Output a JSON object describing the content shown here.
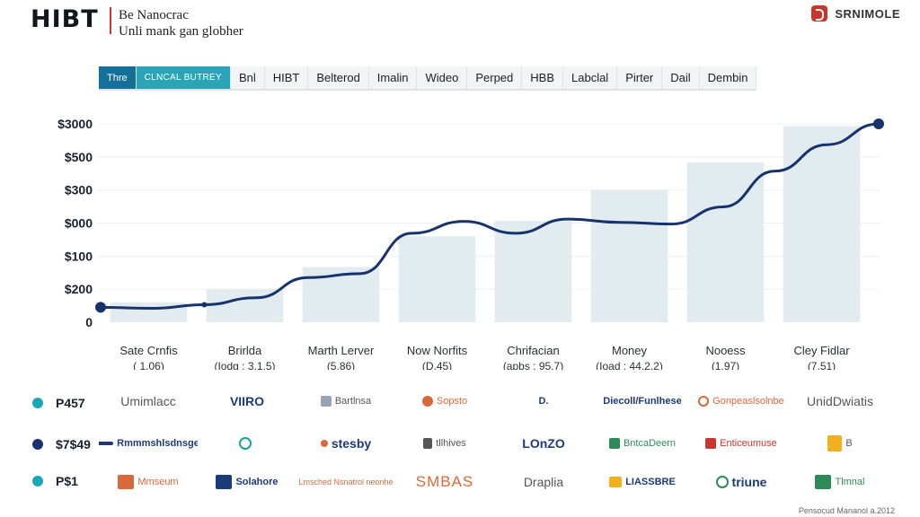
{
  "header": {
    "brand": "HIBT",
    "subtitle_line1": "Be Nanocrac",
    "subtitle_line2": "Unli mank gan globher",
    "logo_text": "SRNIMOLE"
  },
  "tabs": [
    "Thre",
    "CLNCAL BUTREY",
    "Bnl",
    "HIBT",
    "Belterod",
    "Imalin",
    "Wideo",
    "Perped",
    "HBB",
    "Labclal",
    "Pirter",
    "Dail",
    "Dembin"
  ],
  "colors": {
    "line": "#17336e",
    "bar": "#dde9ed",
    "tab_active": "#14709a",
    "tab_active_2": "#2aa5b8",
    "legend_teal": "#1aa8b6",
    "legend_navy": "#17336e",
    "accent_red": "#c9362b"
  },
  "chart_data": {
    "type": "bar",
    "y_ticks": [
      "$3000",
      "$500",
      "$300",
      "$000",
      "$100",
      "$200",
      "0"
    ],
    "categories": [
      {
        "name": "Sate Crnfis",
        "sub": "( 1.06)"
      },
      {
        "name": "Brirlda",
        "sub": "(Iodg : 3.1.5)"
      },
      {
        "name": "Marth Lerver",
        "sub": "(5.86)"
      },
      {
        "name": "Now Norfits",
        "sub": "(D.45)"
      },
      {
        "name": "Chrifacian",
        "sub": "(apbs : 95.7)"
      },
      {
        "name": "Money",
        "sub": "(Ioad : 44,2.2)"
      },
      {
        "name": "Nooess",
        "sub": "(1.97)"
      },
      {
        "name": "Cley Fidlar",
        "sub": "(7.51)"
      }
    ],
    "bar_levels": [
      0,
      0.18,
      0.3,
      0.5,
      0.78,
      0.92,
      1.2,
      1.45,
      1.78
    ],
    "bar_levels_note_removed": true,
    "series": [
      {
        "values": [
          0.45,
          0.42,
          0.53,
          0.74,
          1.35,
          1.47,
          2.69,
          3.05,
          2.69,
          3.12,
          3.02,
          2.97,
          3.49,
          4.57,
          5.37,
          6.0
        ]
      }
    ],
    "ylim": [
      0,
      6
    ],
    "grid": true,
    "legend": "bottom-left"
  },
  "legend": [
    {
      "label": "P457",
      "color": "#1aa8b6"
    },
    {
      "label": "$7$49",
      "color": "#17336e"
    },
    {
      "label": "P$1",
      "color": "#1aa8b6"
    }
  ],
  "brand_rows": [
    [
      {
        "text": "Umimlacc",
        "icon": "wordmark",
        "style": "big"
      },
      {
        "text": "VIIRO",
        "icon": "arc-icon",
        "style": "big"
      },
      {
        "text": "Bartlnsa",
        "icon": "grid-icon",
        "style": ""
      },
      {
        "text": "Sopsto",
        "icon": "flame-icon",
        "style": "orange"
      },
      {
        "text": "D.",
        "icon": "none",
        "style": "navy"
      },
      {
        "text": "Diecoll/Funlhese",
        "icon": "none",
        "style": "navy"
      },
      {
        "text": "Gonpeaslsolnbe",
        "icon": "ring-icon",
        "style": "orange"
      },
      {
        "text": "UnidDwiatis",
        "icon": "none",
        "style": "big"
      }
    ],
    [
      {
        "text": "Rmmmshlsdnsge",
        "icon": "swoosh-icon",
        "style": "navy"
      },
      {
        "text": "",
        "icon": "globe-icon",
        "style": "teal"
      },
      {
        "text": "stesby",
        "icon": "dollar-icon",
        "style": "navy"
      },
      {
        "text": "tllhives",
        "icon": "bars-icon",
        "style": ""
      },
      {
        "text": "LOnZO",
        "icon": "none",
        "style": "navy"
      },
      {
        "text": "BntcaDeern",
        "icon": "square-icon",
        "style": "green"
      },
      {
        "text": "Enticeumuse",
        "icon": "red-square-icon",
        "style": "red"
      },
      {
        "text": "B",
        "icon": "yellow-badge-icon",
        "style": ""
      }
    ],
    [
      {
        "text": "Mmseum",
        "icon": "play-icon",
        "style": "orange"
      },
      {
        "text": "Solahore",
        "icon": "seal-icon",
        "style": "navy"
      },
      {
        "text": "Lmsched Nsnatrol neonhe",
        "icon": "none",
        "style": "orange"
      },
      {
        "text": "SMBAS",
        "icon": "none",
        "style": "orange big"
      },
      {
        "text": "Draplia",
        "icon": "none",
        "style": "big"
      },
      {
        "text": "LIASSBRE",
        "icon": "w-icon",
        "style": "navy"
      },
      {
        "text": "triune",
        "icon": "swirl-icon",
        "style": "navy"
      },
      {
        "text": "Tlmnal",
        "icon": "t-icon",
        "style": "green"
      }
    ]
  ],
  "footer_note": "Pensocud Mananol a.2012"
}
